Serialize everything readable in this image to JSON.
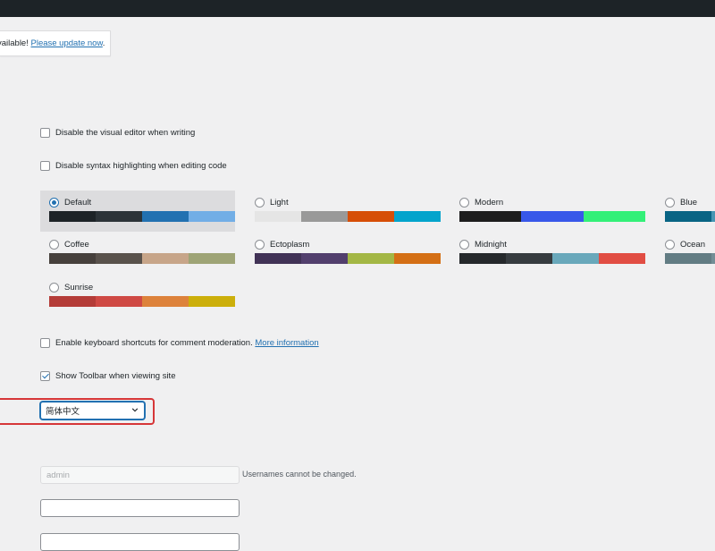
{
  "notice": {
    "text": "vailable! ",
    "link": "Please update now",
    "suffix": "."
  },
  "options": {
    "visual_editor": {
      "label": "Disable the visual editor when writing",
      "checked": false
    },
    "syntax_highlighting": {
      "label": "Disable syntax highlighting when editing code",
      "checked": false
    },
    "keyboard_shortcuts": {
      "label": "Enable keyboard shortcuts for comment moderation.",
      "link": "More information",
      "checked": false
    },
    "toolbar": {
      "label": "Show Toolbar when viewing site",
      "checked": true
    }
  },
  "color_schemes": [
    {
      "name": "Default",
      "selected": true,
      "colors": [
        "#1d2327",
        "#2c3338",
        "#2271b1",
        "#72aee6"
      ]
    },
    {
      "name": "Light",
      "selected": false,
      "colors": [
        "#e5e5e5",
        "#999999",
        "#d64e07",
        "#04a4cc"
      ]
    },
    {
      "name": "Modern",
      "selected": false,
      "colors": [
        "#1e1e1e",
        "#3858e9",
        "#33f078"
      ]
    },
    {
      "name": "Blue",
      "selected": false,
      "colors": [
        "#096484",
        "#4796b3",
        "#52accc",
        "#74b6ce"
      ]
    },
    {
      "name": "Coffee",
      "selected": false,
      "colors": [
        "#46403c",
        "#59524c",
        "#c7a589",
        "#9ea476"
      ]
    },
    {
      "name": "Ectoplasm",
      "selected": false,
      "colors": [
        "#413256",
        "#523f6d",
        "#a3b745",
        "#d46f15"
      ]
    },
    {
      "name": "Midnight",
      "selected": false,
      "colors": [
        "#25282b",
        "#363b3f",
        "#69a8bb",
        "#e14d43"
      ]
    },
    {
      "name": "Ocean",
      "selected": false,
      "colors": [
        "#627c83",
        "#738e96",
        "#9ebaa0",
        "#aa9d88"
      ]
    },
    {
      "name": "Sunrise",
      "selected": false,
      "colors": [
        "#b43c38",
        "#cf4944",
        "#dd823b",
        "#ccaf0b"
      ]
    }
  ],
  "language": {
    "selected": "简体中文"
  },
  "username": {
    "value": "admin",
    "description": "Usernames cannot be changed."
  },
  "first_name": {
    "value": ""
  },
  "colors": {
    "topbar": "#1d2327",
    "accent": "#2271b1",
    "highlight": "#d63638",
    "background": "#f0f0f1"
  }
}
